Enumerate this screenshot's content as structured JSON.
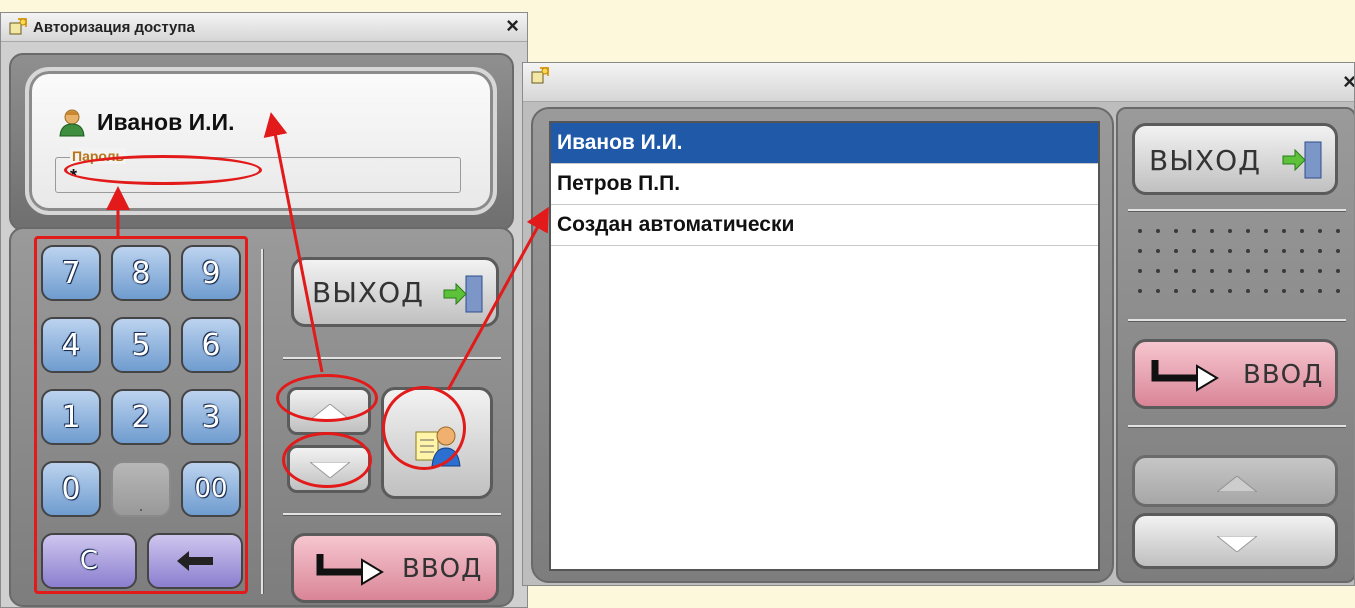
{
  "left_window": {
    "title": "Авторизация доступа",
    "close": "×",
    "user_name": "Иванов И.И.",
    "password_label": "Пароль",
    "password_value": "*",
    "keys": {
      "k7": "7",
      "k8": "8",
      "k9": "9",
      "k4": "4",
      "k5": "5",
      "k6": "6",
      "k1": "1",
      "k2": "2",
      "k3": "3",
      "k0": "0",
      "kdot": ".",
      "k00": "00",
      "kc": "C"
    },
    "exit_label": "ВЫХОД",
    "enter_label": "ВВОД"
  },
  "right_window": {
    "close": "×",
    "users": [
      "Иванов И.И.",
      "Петров П.П.",
      "Создан автоматически"
    ],
    "selected_index": 0,
    "exit_label": "ВЫХОД",
    "enter_label": "ВВОД"
  },
  "colors": {
    "annotation": "#e21a1a",
    "selection": "#1f59a8",
    "background": "#fdf8dc"
  }
}
